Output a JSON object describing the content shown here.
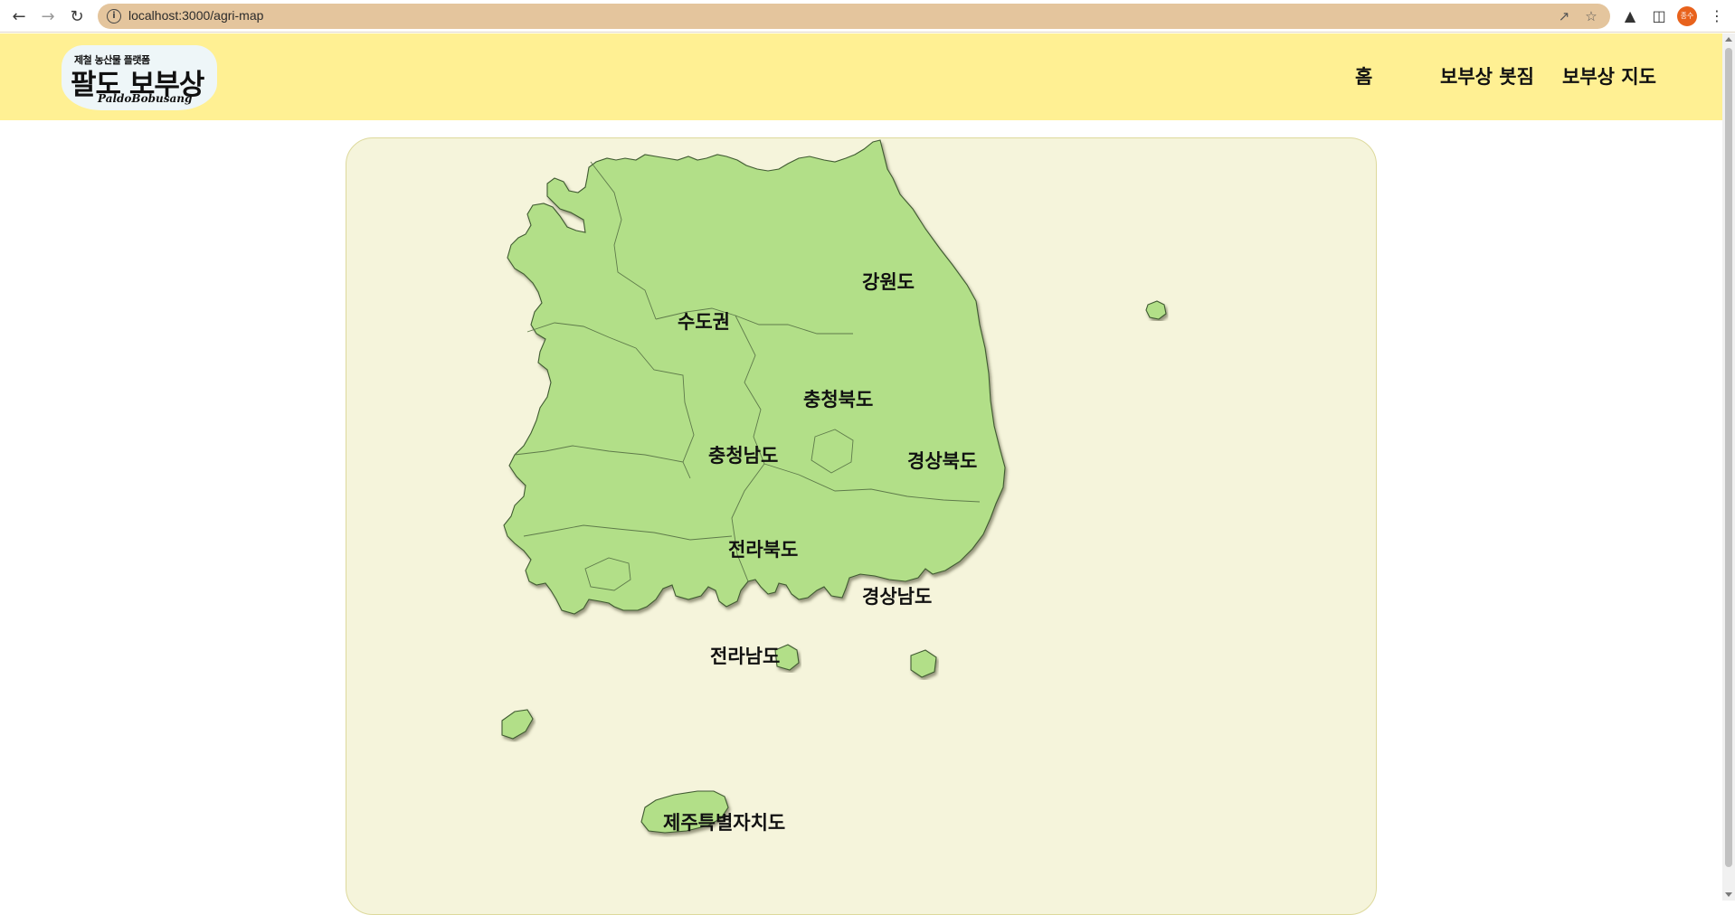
{
  "browser": {
    "url": "localhost:3000/agri-map",
    "profile_initials": "종수",
    "icons": [
      "back-icon",
      "forward-icon",
      "reload-icon",
      "info-icon",
      "share-icon",
      "star-icon",
      "extensions-icon",
      "side-panel-icon",
      "menu-icon"
    ]
  },
  "header": {
    "logo": {
      "tagline": "제철 농산물 플랫폼",
      "name": "팔도 보부상",
      "sub": "PaldoBobusang"
    },
    "nav": [
      "홈",
      "보부상 봇짐",
      "보부상 지도"
    ]
  },
  "map": {
    "regions": [
      {
        "id": "sudogwon",
        "label": "수도권"
      },
      {
        "id": "gangwon",
        "label": "강원도"
      },
      {
        "id": "chungbuk",
        "label": "충청북도"
      },
      {
        "id": "chungnam",
        "label": "충청남도"
      },
      {
        "id": "gyeongbuk",
        "label": "경상북도"
      },
      {
        "id": "jeonbuk",
        "label": "전라북도"
      },
      {
        "id": "gyeongnam",
        "label": "경상남도"
      },
      {
        "id": "jeonnam",
        "label": "전라남도"
      },
      {
        "id": "jeju",
        "label": "제주특별자치도"
      }
    ]
  },
  "colors": {
    "header_bg": "#fff093",
    "omnibox_bg": "#e4c59d",
    "card_bg": "#f5f4db",
    "region_fill": "#b2df88",
    "avatar_bg": "#e8621c"
  }
}
